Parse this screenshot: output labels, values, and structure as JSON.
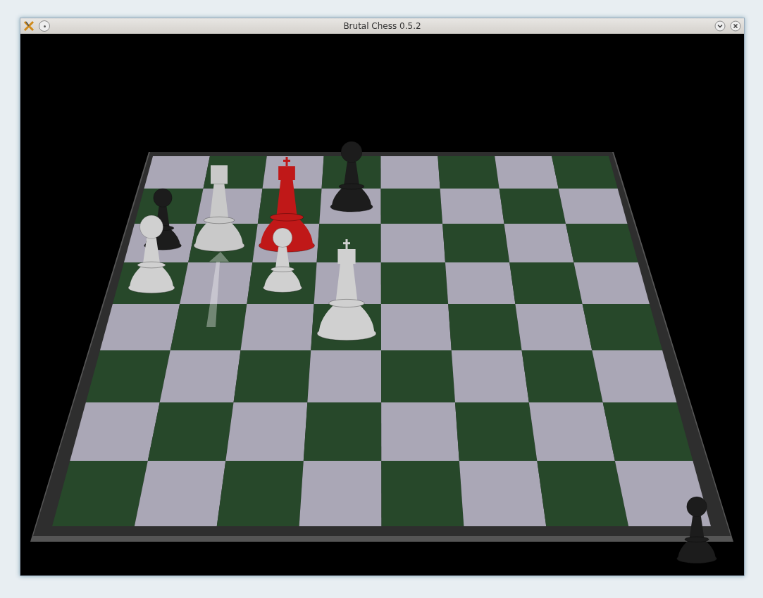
{
  "window": {
    "title": "Brutal Chess 0.5.2"
  }
}
